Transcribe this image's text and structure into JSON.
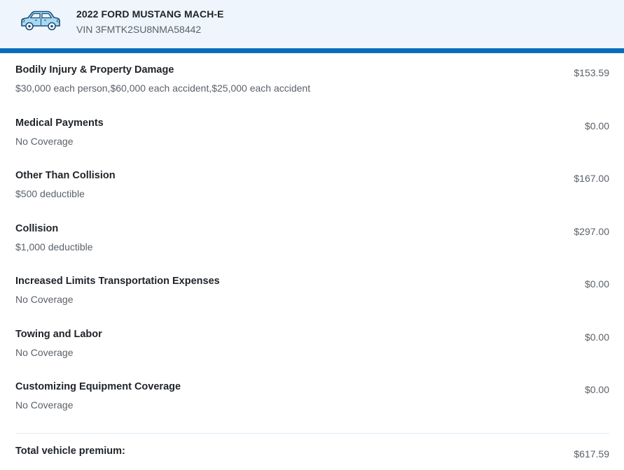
{
  "vehicle": {
    "icon": "car-icon",
    "title": "2022 FORD MUSTANG MACH-E",
    "vin": "VIN 3FMTK2SU8NMA58442"
  },
  "coverages": [
    {
      "name": "Bodily Injury & Property Damage",
      "detail": "$30,000 each person,$60,000 each accident,$25,000 each accident",
      "price": "$153.59"
    },
    {
      "name": "Medical Payments",
      "detail": "No Coverage",
      "price": "$0.00"
    },
    {
      "name": "Other Than Collision",
      "detail": "$500 deductible",
      "price": "$167.00"
    },
    {
      "name": "Collision",
      "detail": "$1,000 deductible",
      "price": "$297.00"
    },
    {
      "name": "Increased Limits Transportation Expenses",
      "detail": "No Coverage",
      "price": "$0.00"
    },
    {
      "name": "Towing and Labor",
      "detail": "No Coverage",
      "price": "$0.00"
    },
    {
      "name": "Customizing Equipment Coverage",
      "detail": "No Coverage",
      "price": "$0.00"
    }
  ],
  "total": {
    "label": "Total vehicle premium:",
    "value": "$617.59"
  },
  "colors": {
    "header_bg": "#eef5fd",
    "accent_bar": "#0b6dba",
    "car_fill": "#a9d9f2",
    "car_stroke": "#1d4f7a"
  }
}
